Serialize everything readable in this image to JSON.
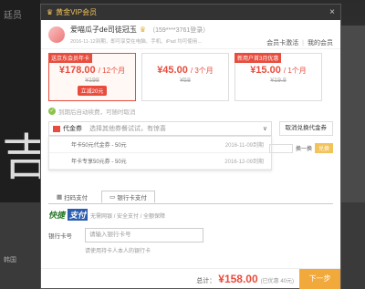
{
  "background": {
    "top_text": "廷员",
    "big_chars": "吉",
    "bottom_text": "韩国"
  },
  "titlebar": {
    "title": "黄金VIP会员",
    "close": "×"
  },
  "user": {
    "name": "爱喵瓜子de司徒冠玉",
    "phone": "（159****3761登录）",
    "desc": "2016-11-12到期，即可享受在电脑、手机、iPad 均可使用…",
    "link_activate": "会员卡激活",
    "link_sep": "|",
    "link_mine": "我的会员"
  },
  "plans": [
    {
      "tag": "送京东会员年卡",
      "price": "¥178.00",
      "unit": "/ 12个月",
      "orig": "¥198",
      "coupon": "立减20元"
    },
    {
      "tag": "",
      "price": "¥45.00",
      "unit": "/ 3个月",
      "orig": "¥58",
      "coupon": ""
    },
    {
      "tag": "新用户首3月优惠",
      "price": "¥15.00",
      "unit": "/ 1个月",
      "orig": "¥19.8",
      "coupon": ""
    }
  ],
  "autorenew": "到期后自动续费，可随时取消",
  "voucher": {
    "label": "代金券",
    "placeholder": "选择其他券餐试试，有惊喜",
    "chevron": "∨",
    "cancel_btn": "取消兑换代金券",
    "items": [
      {
        "text": "年卡50元代金券 - 50元",
        "date": "2016-11-09到期"
      },
      {
        "text": "年卡专享50元券 - 50元",
        "date": "2016-12-09到期"
      }
    ],
    "exchange_label": "换一换",
    "exchange_btn": "兑换"
  },
  "pay": {
    "tab_scan": "扫码支付",
    "tab_card": "银行卡支付",
    "brand1": "快捷",
    "brand2": "支付",
    "brand_desc": "无需网银 / 安全支付 / 全额保障",
    "card_label": "银行卡号",
    "card_placeholder": "请输入银行卡号",
    "card_hint": "请使用持卡人本人的银行卡"
  },
  "footer": {
    "total_label": "总计：",
    "total_amount": "¥158.00",
    "saved": "(已优惠 40元)",
    "next": "下一步"
  },
  "colors": {
    "accent": "#e84c3d",
    "gold": "#f2c35b",
    "orange_btn": "#f2a93b"
  }
}
